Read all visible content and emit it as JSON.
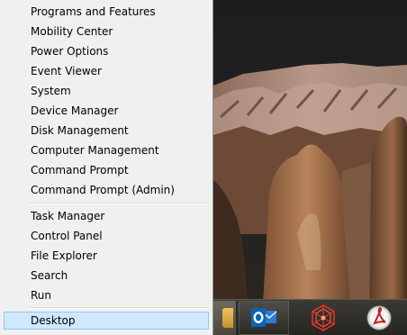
{
  "menu": {
    "groups": [
      [
        "Programs and Features",
        "Mobility Center",
        "Power Options",
        "Event Viewer",
        "System",
        "Device Manager",
        "Disk Management",
        "Computer Management",
        "Command Prompt",
        "Command Prompt (Admin)"
      ],
      [
        "Task Manager",
        "Control Panel",
        "File Explorer",
        "Search",
        "Run"
      ],
      [
        "Desktop"
      ]
    ],
    "selected": "Desktop"
  },
  "taskbar": {
    "apps": [
      "partial-app-icon",
      "outlook-icon",
      "network-app-icon",
      "pdf-reader-icon"
    ],
    "active_app": "outlook-icon"
  },
  "colors": {
    "menu_bg": "#f0f0f0",
    "menu_selected_bg": "#cde8ff",
    "menu_selected_border": "#99c7f5",
    "taskbar_bg": "#26241f",
    "outlook_blue": "#0a64b4",
    "network_red": "#e0352b",
    "reader_red": "#c81e1e"
  }
}
